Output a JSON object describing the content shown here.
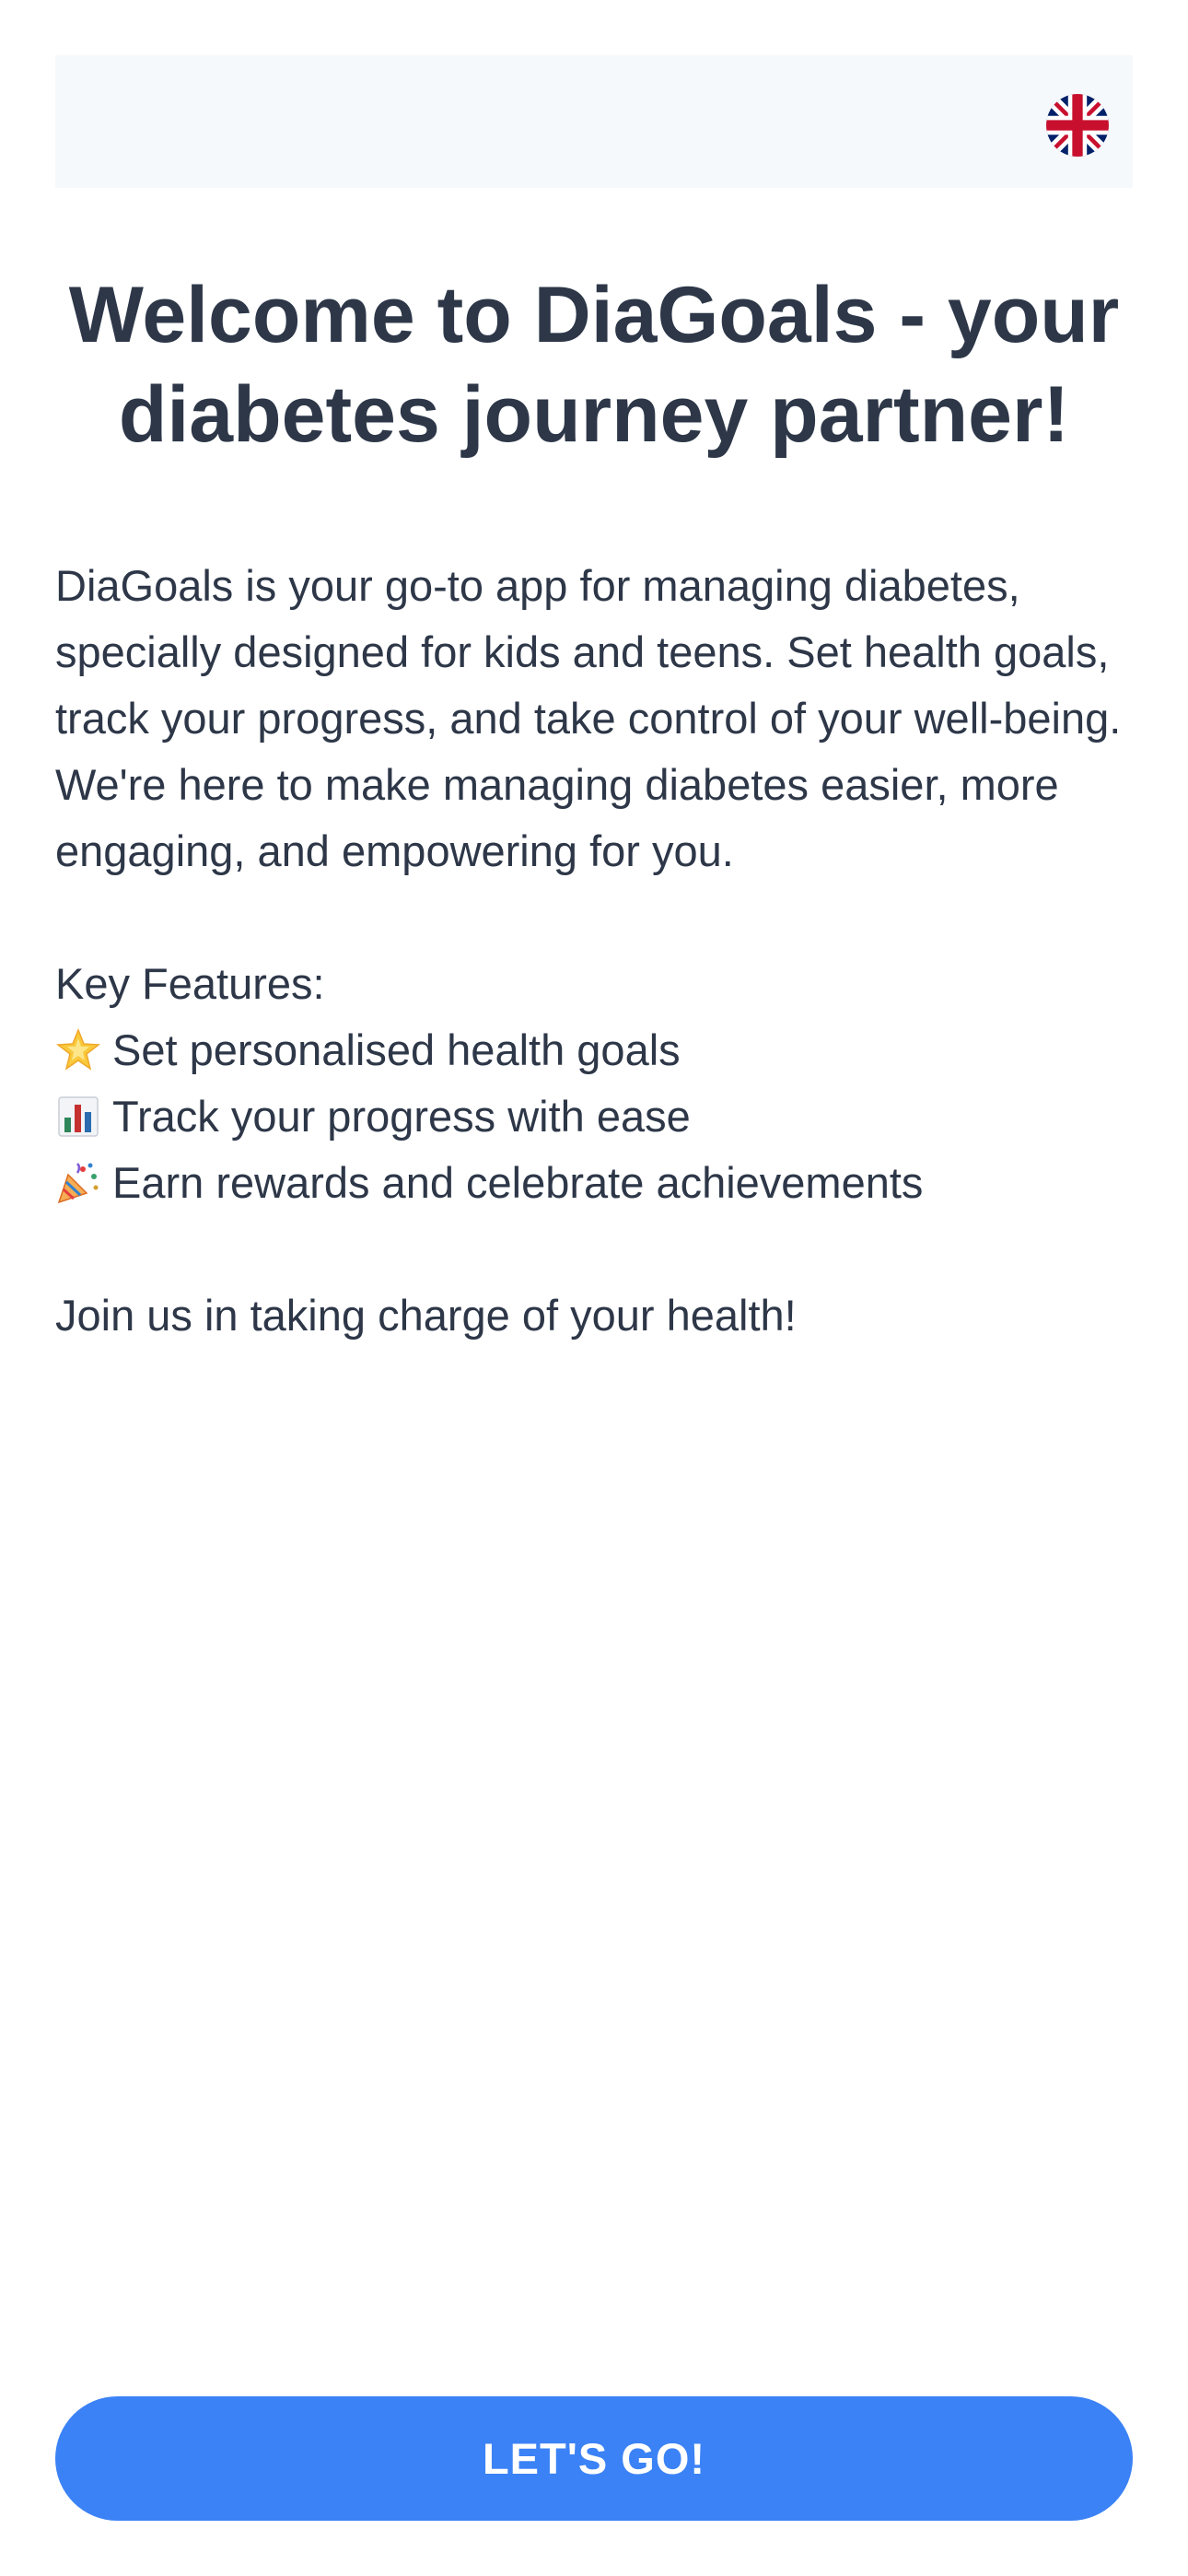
{
  "header": {
    "language_icon": "uk-flag-icon",
    "background_color": "#f6f9fc"
  },
  "welcome": {
    "title": "Welcome to DiaGoals - your diabetes journey partner!",
    "intro": "DiaGoals is your go-to app for managing diabetes, specially designed for kids and teens. Set health goals, track your progress, and take control of your well-being. We're here to make managing diabetes easier, more engaging, and empowering for you.",
    "features_heading": "Key Features:",
    "features": [
      {
        "icon": "star-icon",
        "text": "Set personalised health goals"
      },
      {
        "icon": "bar-chart-icon",
        "text": "Track your progress with ease"
      },
      {
        "icon": "party-popper-icon",
        "text": "Earn rewards and celebrate achievements"
      }
    ],
    "closing": "Join us in taking charge of your health!"
  },
  "cta": {
    "label": "LET'S GO!",
    "color": "#3b82f6"
  },
  "colors": {
    "text": "#2d3748"
  }
}
